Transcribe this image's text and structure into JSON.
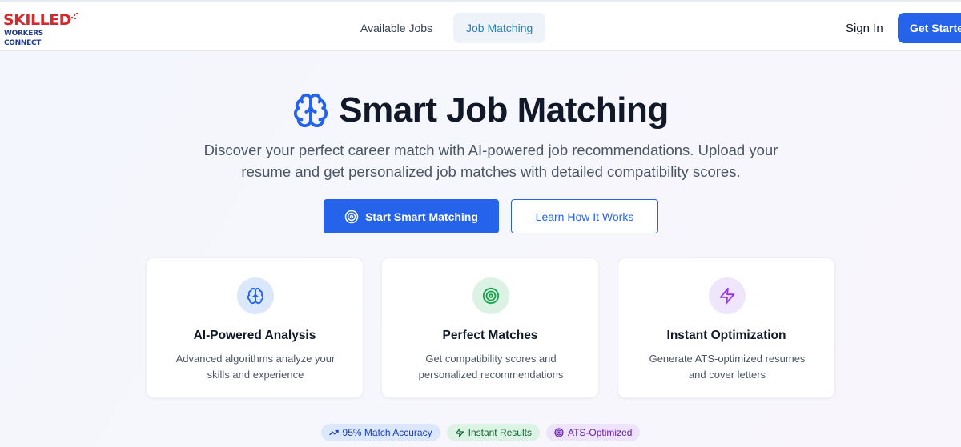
{
  "header": {
    "logo_top": "SKILLED",
    "logo_bottom": "WORKERS CONNECT",
    "nav": [
      "Available Jobs",
      "Job Matching"
    ],
    "sign_in": "Sign In",
    "get_started": "Get Started"
  },
  "hero": {
    "title": "Smart Job Matching",
    "description": "Discover your perfect career match with AI-powered job recommendations. Upload your resume and get personalized job matches with detailed compatibility scores.",
    "primary_button": "Start Smart Matching",
    "secondary_button": "Learn How It Works"
  },
  "features": [
    {
      "title": "AI-Powered Analysis",
      "description": "Advanced algorithms analyze your skills and experience",
      "icon": "brain-icon",
      "color": "#2563eb",
      "bg": "#dbe7fb"
    },
    {
      "title": "Perfect Matches",
      "description": "Get compatibility scores and personalized recommendations",
      "icon": "target-icon",
      "color": "#16a34a",
      "bg": "#dcf2e4"
    },
    {
      "title": "Instant Optimization",
      "description": "Generate ATS-optimized resumes and cover letters",
      "icon": "lightning-icon",
      "color": "#9333ea",
      "bg": "#f0e6fb"
    }
  ],
  "badges": [
    {
      "label": "95% Match Accuracy",
      "icon": "trending-up-icon"
    },
    {
      "label": "Instant Results",
      "icon": "lightning-icon"
    },
    {
      "label": "ATS-Optimized",
      "icon": "target-icon"
    }
  ],
  "colors": {
    "accent": "#2563eb",
    "logo_red": "#d12a2f",
    "logo_blue": "#1f3a8a",
    "nav_active": "#2b7fb3"
  }
}
